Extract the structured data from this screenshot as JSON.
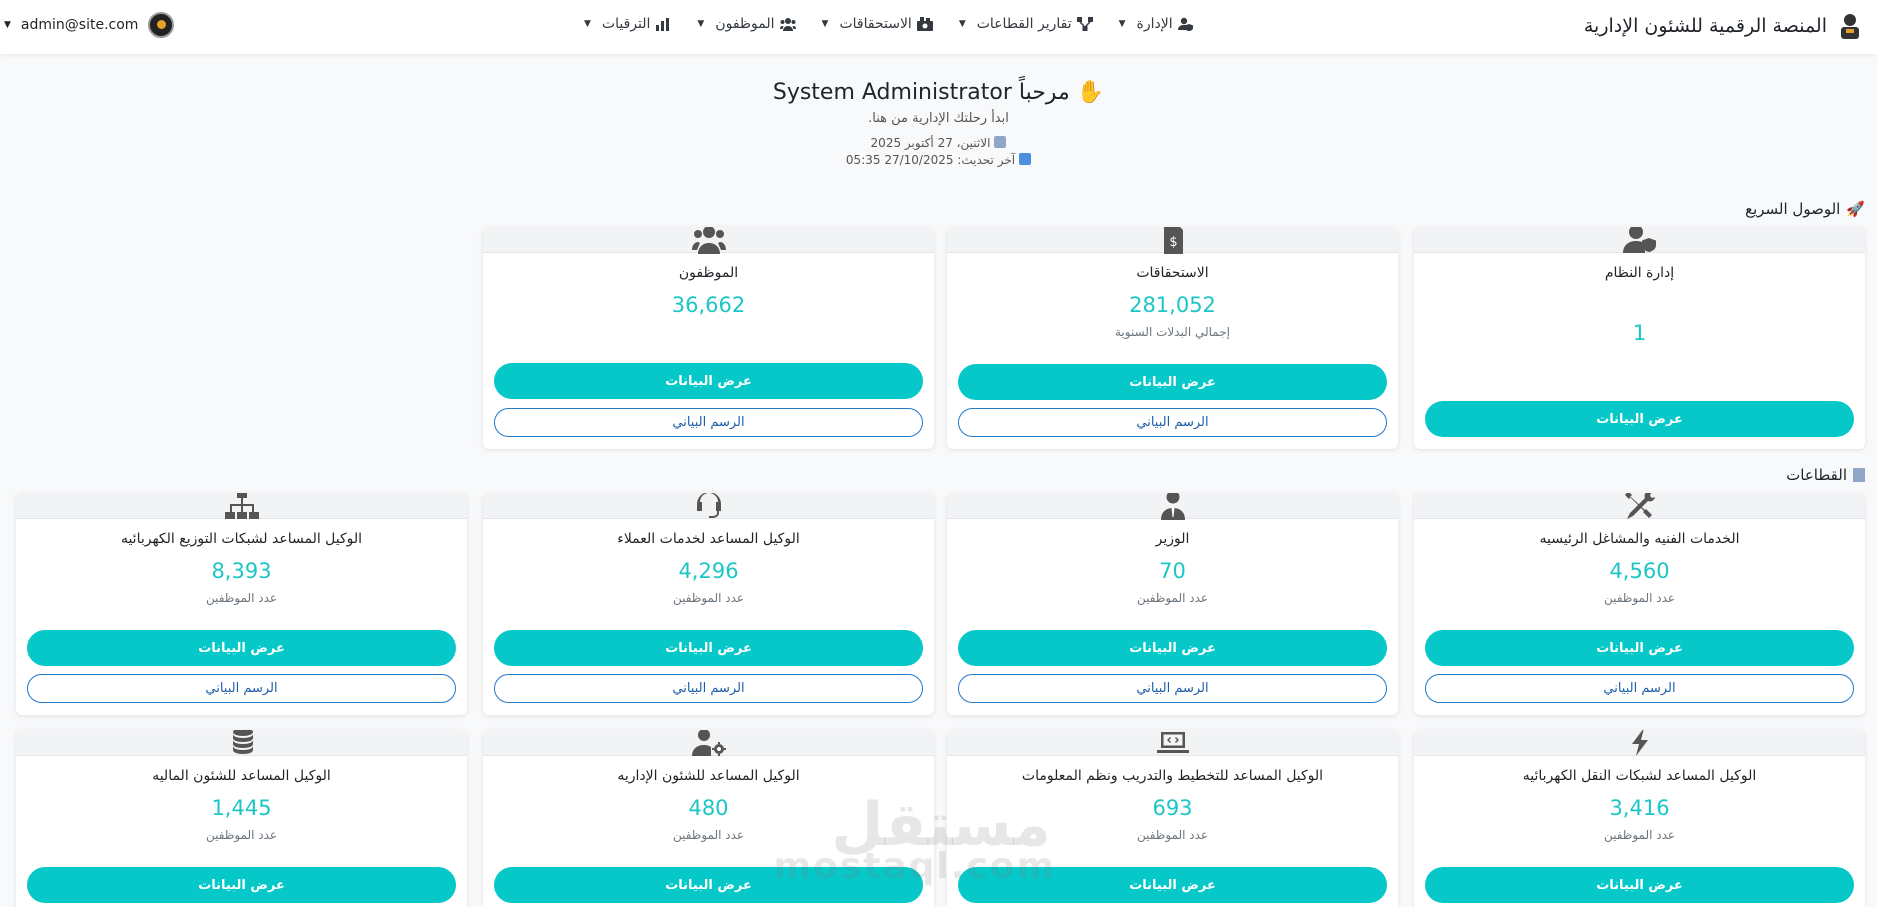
{
  "navbar": {
    "brand": "المنصة الرقمية للشئون الإدارية",
    "menu": [
      {
        "label": "الإدارة",
        "icon": "user-shield-icon"
      },
      {
        "label": "تقارير القطاعات",
        "icon": "network-icon"
      },
      {
        "label": "الاستحقاقات",
        "icon": "money-icon"
      },
      {
        "label": "الموظفون",
        "icon": "users-icon"
      },
      {
        "label": "الترقيات",
        "icon": "chart-icon"
      }
    ],
    "user_email": "admin@site.com"
  },
  "welcome": {
    "title": "مرحباً System Administrator",
    "subtitle": "ابدأ رحلتك الإدارية من هنا.",
    "date": "الاثنين، 27 أكتوبر 2025",
    "updated": "آخر تحديث: 27/10/2025 05:35"
  },
  "quick_access": {
    "title": "الوصول السريع",
    "cards": [
      {
        "title": "إدارة النظام",
        "value": "1",
        "icon": "user-shield-icon",
        "view": "عرض البيانات"
      },
      {
        "title": "الاستحقاقات",
        "value": "281,052",
        "note": "إجمالي البدلات السنوية",
        "icon": "invoice-dollar-icon",
        "view": "عرض البيانات",
        "chart": "الرسم البياني"
      },
      {
        "title": "الموظفون",
        "value": "36,662",
        "icon": "users-icon",
        "view": "عرض البيانات",
        "chart": "الرسم البياني"
      }
    ]
  },
  "sectors": {
    "title": "القطاعات",
    "note": "عدد الموظفين",
    "view": "عرض البيانات",
    "chart": "الرسم البياني",
    "cards": [
      {
        "title": "الخدمات الفنيه والمشاغل الرئيسيه",
        "value": "4,560",
        "icon": "tools-icon"
      },
      {
        "title": "الوزير",
        "value": "70",
        "icon": "user-tie-icon"
      },
      {
        "title": "الوكيل المساعد لخدمات العملاء",
        "value": "4,296",
        "icon": "headset-icon"
      },
      {
        "title": "الوكيل المساعد لشبكات التوزيع الكهربائيه",
        "value": "8,393",
        "icon": "sitemap-icon"
      },
      {
        "title": "الوكيل المساعد لشبكات النقل الكهربائيه",
        "value": "3,416",
        "icon": "bolt-icon"
      },
      {
        "title": "الوكيل المساعد للتخطيط والتدريب ونظم المعلومات",
        "value": "693",
        "icon": "laptop-code-icon"
      },
      {
        "title": "الوكيل المساعد للشئون الإداريه",
        "value": "480",
        "icon": "users-cog-icon"
      },
      {
        "title": "الوكيل المساعد للشئون الماليه",
        "value": "1,445",
        "icon": "coins-icon"
      }
    ]
  },
  "watermark": {
    "line1": "مستقل",
    "line2": "mostaql.com"
  }
}
